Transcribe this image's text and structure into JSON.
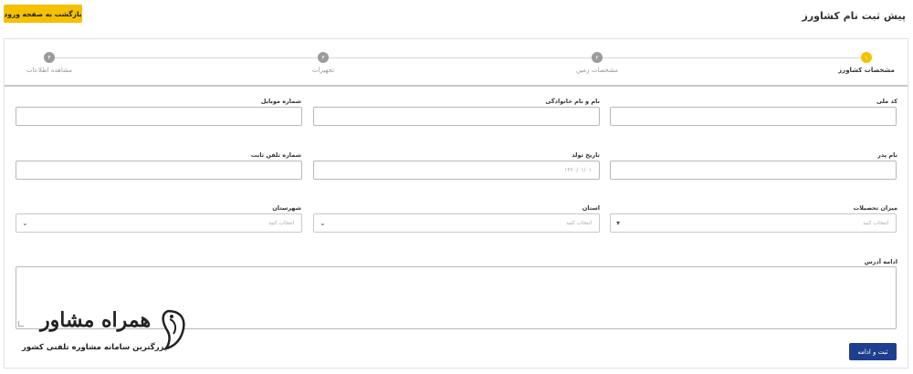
{
  "header": {
    "title": "پیش ثبت نام کشاورز",
    "back_button": "بازگشت به صفحه ورود"
  },
  "steps": [
    {
      "number": "۱",
      "label": "مشخصات کشاورز",
      "active": true
    },
    {
      "number": "۲",
      "label": "مشخصات زمین",
      "active": false
    },
    {
      "number": "۳",
      "label": "تجهیزات",
      "active": false
    },
    {
      "number": "۴",
      "label": "مشاهده اطلاعات",
      "active": false
    }
  ],
  "form": {
    "national_code": {
      "label": "کد ملی",
      "value": ""
    },
    "full_name": {
      "label": "نام و نام خانوادگی",
      "value": ""
    },
    "mobile": {
      "label": "شماره موبایل",
      "value": ""
    },
    "father_name": {
      "label": "نام پدر",
      "value": ""
    },
    "birth_date": {
      "label": "تاریخ تولد",
      "placeholder": "۱۳۶۰/۰۱/۰۱"
    },
    "landline": {
      "label": "شماره تلفن ثابت",
      "value": ""
    },
    "education": {
      "label": "میزان تحصیلات",
      "placeholder": "انتخاب کنید"
    },
    "province": {
      "label": "استان",
      "placeholder": "انتخاب کنید"
    },
    "city": {
      "label": "شهرستان",
      "placeholder": "انتخاب کنید"
    },
    "address": {
      "label": "ادامه آدرس",
      "value": ""
    }
  },
  "submit_button": "ثبت و ادامه",
  "watermark": {
    "title": "همراه مشاور",
    "subtitle": "بزرگترین سامانه مشاوره تلفنی کشور"
  },
  "colors": {
    "accent": "#f5c000",
    "primary": "#1e3f8f",
    "inactive_step": "#9b9b9b"
  }
}
